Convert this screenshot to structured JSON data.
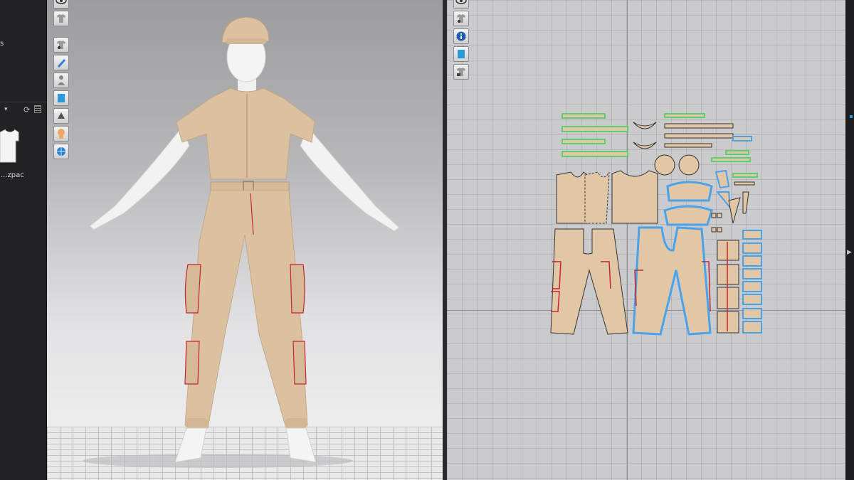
{
  "library": {
    "partial_text": "s",
    "dropdown_arrow": "▾",
    "refresh_icon": "⟳",
    "file_name": "...zpac"
  },
  "toolbar_3d": {
    "buttons": [
      "show-avatar-icon",
      "show-garment-icon",
      "show-garment-2-icon",
      "brush-icon",
      "avatar-pose-icon",
      "texture-icon",
      "surface-icon",
      "skin-icon",
      "globe-icon"
    ]
  },
  "toolbar_2d": {
    "buttons": [
      "show-pattern-icon",
      "show-garment-2d-icon",
      "info-icon",
      "texture-2d-icon",
      "lock-garment-icon"
    ]
  },
  "colors": {
    "fabric": "#e2c7a6",
    "seam_red": "#c8232c",
    "pattern_outline_blue": "#4aa3e8",
    "pattern_outline_green": "#5ccf74",
    "bg_dark": "#1b1b1d"
  },
  "rightstrip": {
    "arrow": "▶"
  }
}
